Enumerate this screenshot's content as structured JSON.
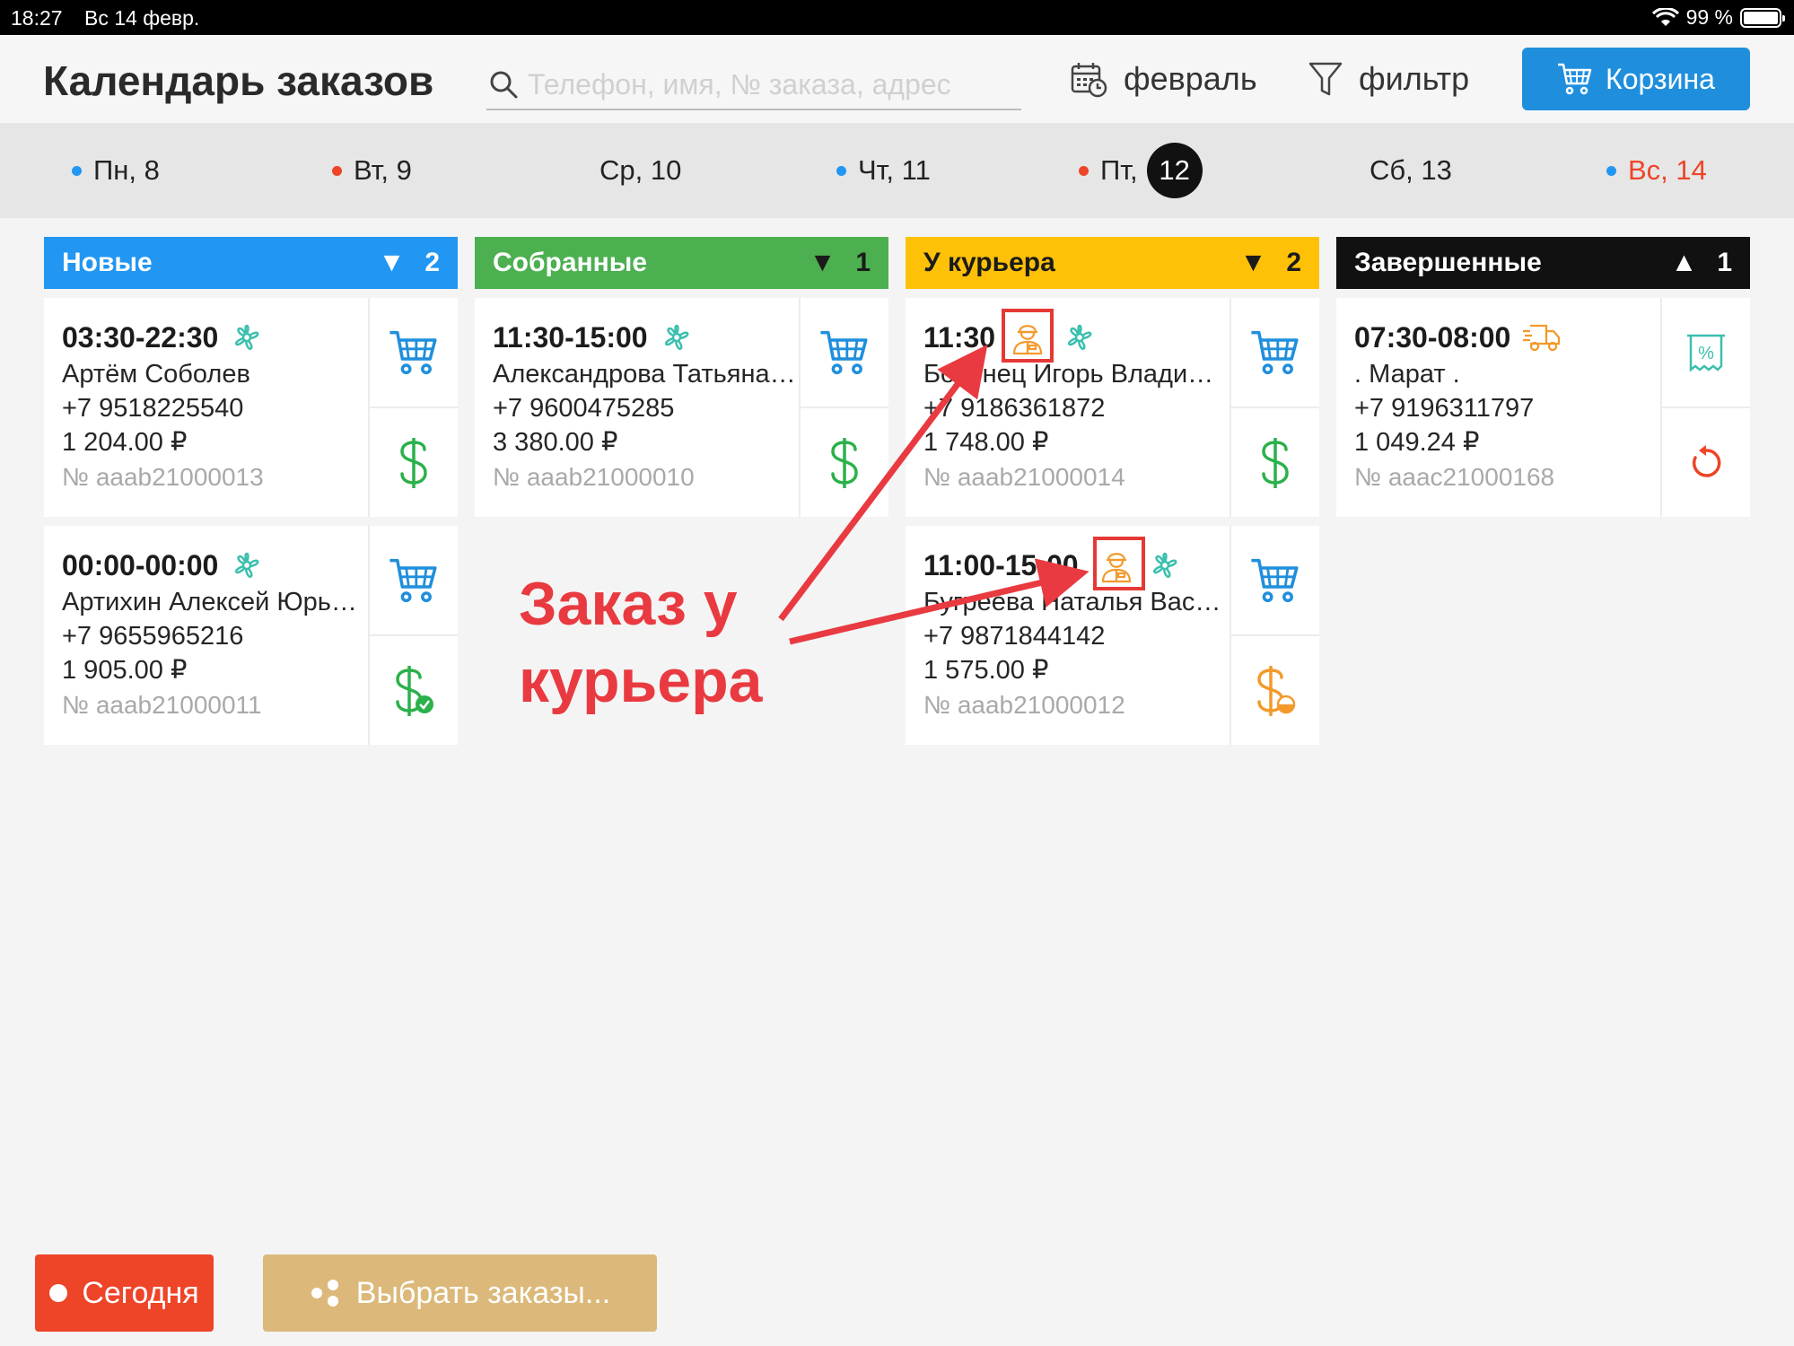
{
  "status_bar": {
    "time": "18:27",
    "date": "Вс 14 февр.",
    "battery": "99 %"
  },
  "header": {
    "title": "Календарь заказов",
    "search_placeholder": "Телефон, имя, № заказа, адрес",
    "month_label": "февраль",
    "filter_label": "фильтр",
    "cart_label": "Корзина"
  },
  "colors": {
    "accent_blue": "#1f8fdd",
    "new": "#2196f3",
    "collected": "#4caf50",
    "courier": "#ffc107",
    "done": "#111111",
    "red": "#ee4428",
    "orange": "#f39a2b"
  },
  "days": [
    {
      "label": "Пн, 8",
      "dot": "#2196f3"
    },
    {
      "label": "Вт, 9",
      "dot": "#ee4428"
    },
    {
      "label": "Ср, 10",
      "dot": ""
    },
    {
      "label": "Чт, 11",
      "dot": "#2196f3"
    },
    {
      "label": "Пт,",
      "dot": "#ee4428",
      "badge": "12"
    },
    {
      "label": "Сб, 13",
      "dot": ""
    },
    {
      "label": "Вс, 14",
      "dot": "#2196f3",
      "color": "#ee4428"
    }
  ],
  "columns": [
    {
      "title": "Новые",
      "count": "2",
      "arrow": "▼",
      "cards": [
        {
          "time": "03:30-22:30",
          "name": "Артём Соболев",
          "phone": "+7 9518225540",
          "sum": "1 204.00 ₽",
          "number": "№ aaab21000013"
        },
        {
          "time": "00:00-00:00",
          "name": "Артихин  Алексей  Юрьевич",
          "phone": "+7 9655965216",
          "sum": "1 905.00 ₽",
          "number": "№ aaab21000011"
        }
      ]
    },
    {
      "title": "Собранные",
      "count": "1",
      "arrow": "▼",
      "cards": [
        {
          "time": "11:30-15:00",
          "name": "Александрова Татьяна Николаевна",
          "phone": "+7 9600475285",
          "sum": "3 380.00 ₽",
          "number": "№ aaab21000010"
        }
      ]
    },
    {
      "title": "У курьера",
      "count": "2",
      "arrow": "▼",
      "cards": [
        {
          "time": "11:30",
          "name": "Бобунец Игорь Владимирович",
          "phone": "+7 9186361872",
          "sum": "1 748.00 ₽",
          "number": "№ aaab21000014"
        },
        {
          "time": "11:00-15:00",
          "name": "Бугреева Наталья Васильевна",
          "phone": "+7 9871844142",
          "sum": "1 575.00 ₽",
          "number": "№ aaab21000012"
        }
      ]
    },
    {
      "title": "Завершенные",
      "count": "1",
      "arrow": "▲",
      "cards": [
        {
          "time": "07:30-08:00",
          "name": ". Марат .",
          "phone": "+7 9196311797",
          "sum": "1 049.24 ₽",
          "number": "№ aaac21000168"
        }
      ]
    }
  ],
  "annotation": {
    "line1": "Заказ у",
    "line2": "курьера"
  },
  "bottom": {
    "today_label": "Сегодня",
    "select_label": "Выбрать заказы..."
  }
}
